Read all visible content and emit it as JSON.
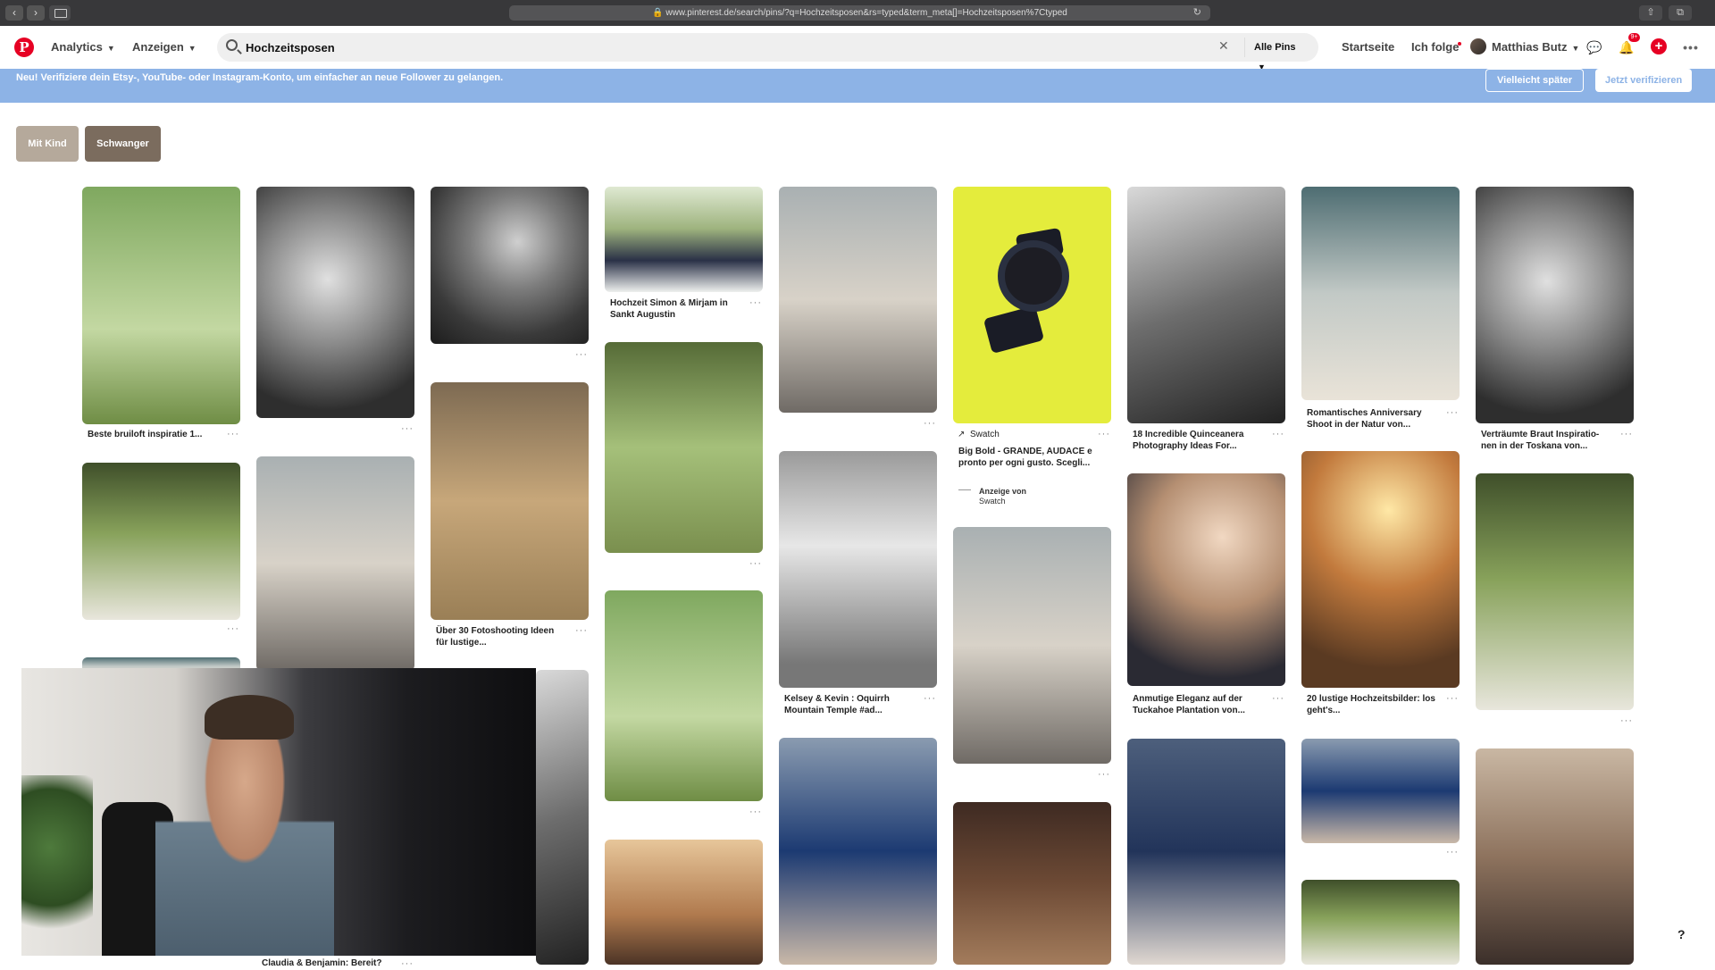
{
  "browser": {
    "url": "www.pinterest.de/search/pins/?q=Hochzeitsposen&rs=typed&term_meta[]=Hochzeitsposen%7Ctyped"
  },
  "header": {
    "logo": "P",
    "nav": [
      {
        "label": "Analytics"
      },
      {
        "label": "Anzeigen"
      }
    ],
    "search_value": "Hochzeitsposen",
    "scope": "Alle Pins",
    "links": {
      "home": "Startseite",
      "following": "Ich folge",
      "user": "Matthias Butz"
    },
    "notifications_badge": "9+"
  },
  "banner": {
    "text": "Neu! Verifiziere dein Etsy-, YouTube- oder Instagram-Konto, um einfacher an neue Follower zu gelangen.",
    "later": "Vielleicht später",
    "verify": "Jetzt verifizieren"
  },
  "filters": [
    {
      "label": "Mit Kind",
      "color": "#b5a99b"
    },
    {
      "label": "Schwanger",
      "color": "#7b6c5e"
    }
  ],
  "pins": [
    {
      "caption": "Beste bruiloft inspiratie 1..."
    },
    {
      "caption": "Hochzeit Simon & Mirjam in Sankt Augustin"
    },
    {
      "caption": "Über 30 Fotoshooting Ideen für lustige..."
    },
    {
      "caption": "Kelsey & Kevin : Oquirrh Mountain Temple #ad..."
    },
    {
      "caption": "Swatch"
    },
    {
      "caption": "Big Bold - GRANDE, AUDACE e pronto per ogni gusto. Scegli..."
    },
    {
      "caption": "Anzeige von"
    },
    {
      "caption": "Swatch"
    },
    {
      "caption": "18 Incredible Quinceanera Photography Ideas For..."
    },
    {
      "caption": "Anmutige Eleganz auf der Tuckahoe Plantation von..."
    },
    {
      "caption": "Romantisches Anniversary Shoot in der Natur von..."
    },
    {
      "caption": "20 lustige Hochzeitsbilder: los geht's..."
    },
    {
      "caption": "Verträumte Braut Inspiratio- nen in der Toskana von..."
    },
    {
      "caption": "Claudia & Benjamin: Bereit?"
    }
  ],
  "more_label": "···",
  "help": "?"
}
